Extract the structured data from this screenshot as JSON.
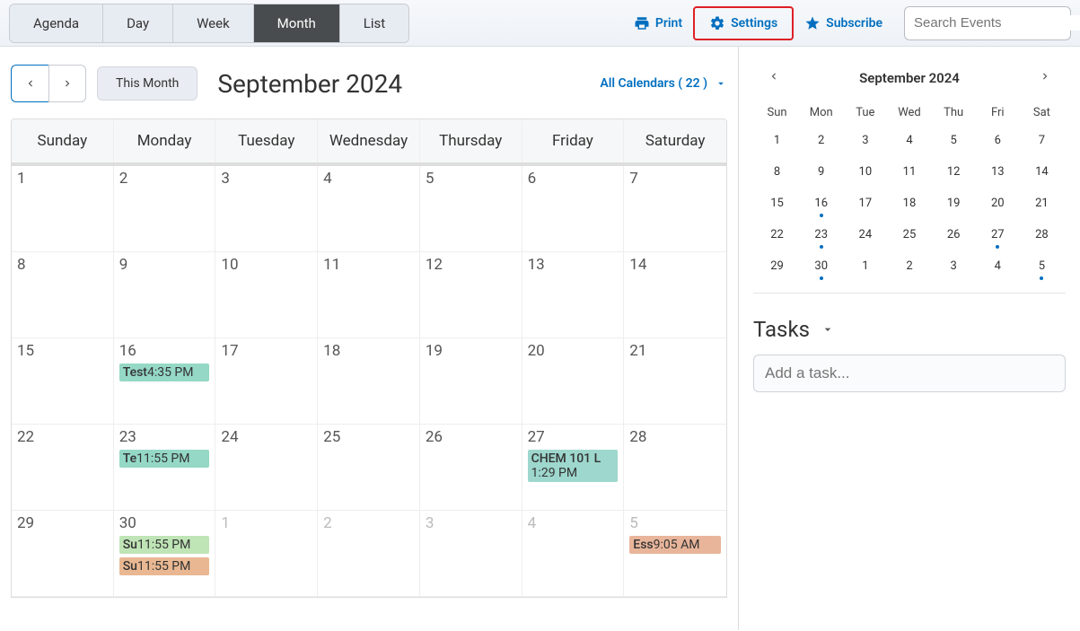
{
  "toolbar": {
    "views": [
      "Agenda",
      "Day",
      "Week",
      "Month",
      "List"
    ],
    "active_view": "Month",
    "print_label": "Print",
    "settings_label": "Settings",
    "subscribe_label": "Subscribe",
    "search_placeholder": "Search Events"
  },
  "cal": {
    "this_month_label": "This Month",
    "title": "September 2024",
    "all_calendars_label": "All Calendars ( 22 )",
    "dows": [
      "Sunday",
      "Monday",
      "Tuesday",
      "Wednesday",
      "Thursday",
      "Friday",
      "Saturday"
    ],
    "weeks": [
      [
        {
          "n": "1"
        },
        {
          "n": "2"
        },
        {
          "n": "3"
        },
        {
          "n": "4"
        },
        {
          "n": "5"
        },
        {
          "n": "6"
        },
        {
          "n": "7"
        }
      ],
      [
        {
          "n": "8"
        },
        {
          "n": "9"
        },
        {
          "n": "10"
        },
        {
          "n": "11"
        },
        {
          "n": "12"
        },
        {
          "n": "13"
        },
        {
          "n": "14"
        }
      ],
      [
        {
          "n": "15"
        },
        {
          "n": "16",
          "events": [
            {
              "title": "Test",
              "time": "4:35 PM",
              "color": "c-teal"
            }
          ]
        },
        {
          "n": "17"
        },
        {
          "n": "18"
        },
        {
          "n": "19"
        },
        {
          "n": "20"
        },
        {
          "n": "21"
        }
      ],
      [
        {
          "n": "22"
        },
        {
          "n": "23",
          "events": [
            {
              "title": "Te",
              "time": "11:55 PM",
              "color": "c-teal"
            }
          ]
        },
        {
          "n": "24"
        },
        {
          "n": "25"
        },
        {
          "n": "26"
        },
        {
          "n": "27",
          "events": [
            {
              "title": "CHEM 101 L",
              "time": "1:29 PM",
              "color": "c-teal2",
              "twoLine": true
            }
          ]
        },
        {
          "n": "28"
        }
      ],
      [
        {
          "n": "29"
        },
        {
          "n": "30",
          "events": [
            {
              "title": "Su",
              "time": "11:55 PM",
              "color": "c-green"
            },
            {
              "title": "Su",
              "time": "11:55 PM",
              "color": "c-orange"
            }
          ]
        },
        {
          "n": "1",
          "fade": true
        },
        {
          "n": "2",
          "fade": true
        },
        {
          "n": "3",
          "fade": true
        },
        {
          "n": "4",
          "fade": true
        },
        {
          "n": "5",
          "fade": true,
          "events": [
            {
              "title": "Ess",
              "time": "9:05 AM",
              "color": "c-salmon"
            }
          ]
        }
      ]
    ]
  },
  "mini": {
    "title": "September 2024",
    "dows": [
      "Sun",
      "Mon",
      "Tue",
      "Wed",
      "Thu",
      "Fri",
      "Sat"
    ],
    "days": [
      {
        "n": "1"
      },
      {
        "n": "2"
      },
      {
        "n": "3"
      },
      {
        "n": "4"
      },
      {
        "n": "5"
      },
      {
        "n": "6"
      },
      {
        "n": "7"
      },
      {
        "n": "8"
      },
      {
        "n": "9"
      },
      {
        "n": "10"
      },
      {
        "n": "11"
      },
      {
        "n": "12"
      },
      {
        "n": "13"
      },
      {
        "n": "14"
      },
      {
        "n": "15"
      },
      {
        "n": "16",
        "dot": true
      },
      {
        "n": "17"
      },
      {
        "n": "18"
      },
      {
        "n": "19"
      },
      {
        "n": "20"
      },
      {
        "n": "21"
      },
      {
        "n": "22"
      },
      {
        "n": "23",
        "dot": true
      },
      {
        "n": "24"
      },
      {
        "n": "25"
      },
      {
        "n": "26"
      },
      {
        "n": "27",
        "dot": true
      },
      {
        "n": "28"
      },
      {
        "n": "29"
      },
      {
        "n": "30",
        "dot": true
      },
      {
        "n": "1"
      },
      {
        "n": "2"
      },
      {
        "n": "3"
      },
      {
        "n": "4"
      },
      {
        "n": "5",
        "dot": true
      }
    ]
  },
  "tasks": {
    "title": "Tasks",
    "placeholder": "Add a task..."
  }
}
